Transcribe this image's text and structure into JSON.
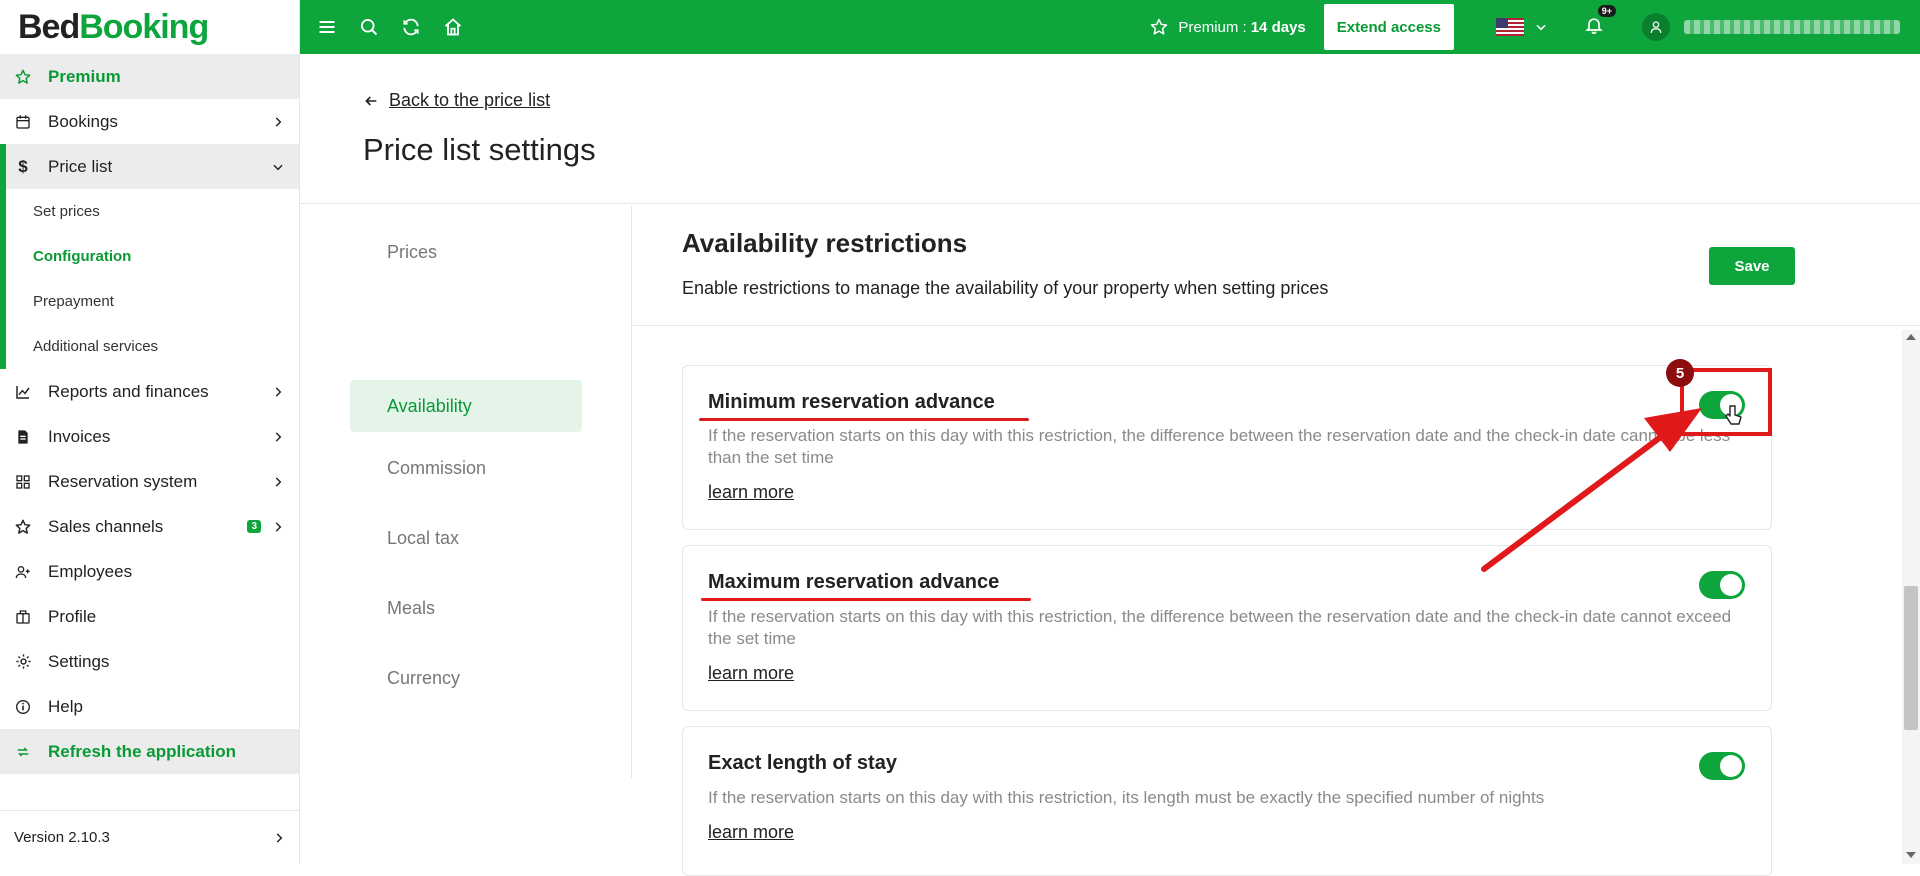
{
  "brand": {
    "part1": "Bed",
    "part2": "Booking"
  },
  "topbar": {
    "premium_label": "Premium :",
    "premium_days": "14 days",
    "extend_label": "Extend access",
    "notifications_count": "9+",
    "flag_icon": "us-flag-icon"
  },
  "sidebar": {
    "premium": "Premium",
    "bookings": "Bookings",
    "price_list": "Price list",
    "sub": {
      "set_prices": "Set prices",
      "configuration": "Configuration",
      "prepayment": "Prepayment",
      "additional_services": "Additional services"
    },
    "reports": "Reports and finances",
    "invoices": "Invoices",
    "reservation_system": "Reservation system",
    "sales_channels": "Sales channels",
    "sales_channels_badge": "3",
    "employees": "Employees",
    "profile": "Profile",
    "settings": "Settings",
    "help": "Help",
    "refresh": "Refresh the application",
    "version": "Version 2.10.3"
  },
  "main": {
    "back_label": "Back to the price list",
    "page_title": "Price list settings",
    "tabs": [
      "Prices",
      "Availability",
      "Commission",
      "Local tax",
      "Meals",
      "Currency"
    ],
    "active_tab": "Availability",
    "section_title": "Availability restrictions",
    "section_desc": "Enable restrictions to manage the availability of your property when setting prices",
    "save_label": "Save",
    "cards": [
      {
        "title": "Minimum reservation advance",
        "desc": "If the reservation starts on this day with this restriction, the difference between the reservation date and the check-in date cannot be less than the set time",
        "more": "learn more",
        "enabled": true
      },
      {
        "title": "Maximum reservation advance",
        "desc": "If the reservation starts on this day with this restriction, the difference between the reservation date and the check-in date cannot exceed the set time",
        "more": "learn more",
        "enabled": true
      },
      {
        "title": "Exact length of stay",
        "desc": "If the reservation starts on this day with this restriction, its length must be exactly the specified number of nights",
        "more": "learn more",
        "enabled": true
      }
    ]
  },
  "annotation": {
    "step": "5",
    "color": "#e01a1a"
  },
  "colors": {
    "brand_green": "#0da53c",
    "text_green": "#0a9a35"
  }
}
